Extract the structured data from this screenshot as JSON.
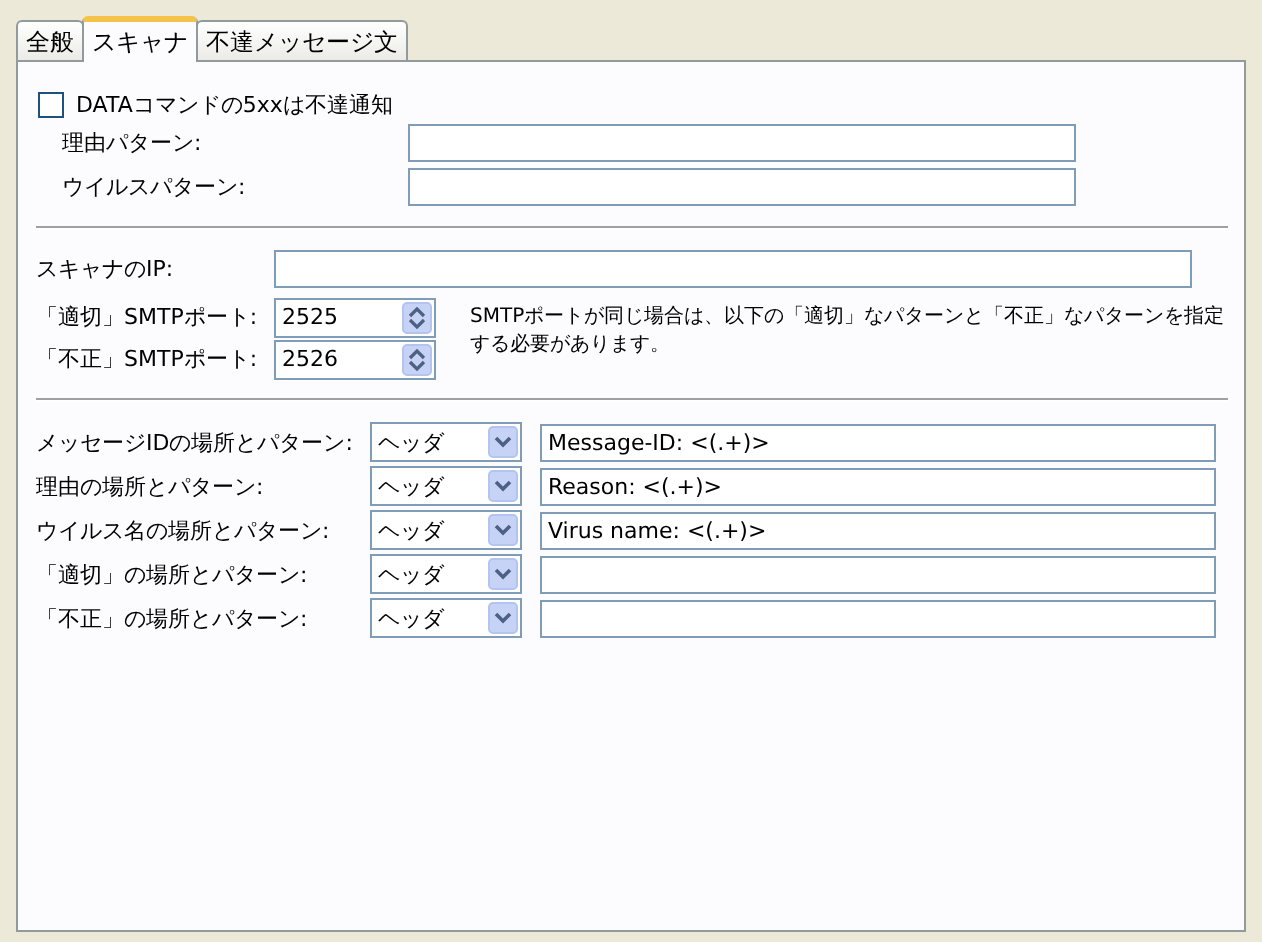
{
  "tabs": [
    {
      "label": "全般",
      "selected": false
    },
    {
      "label": "スキャナ",
      "selected": true
    },
    {
      "label": "不達メッセージ文",
      "selected": false
    }
  ],
  "dsn": {
    "label": "DATAコマンドの5xxは不達通知",
    "checked": false,
    "fields": [
      {
        "label": "理由パターン:"
      },
      {
        "label": "ウイルスパターン:"
      }
    ]
  },
  "scanner_ip": {
    "label": "スキャナのIP:"
  },
  "ports": [
    {
      "label": "「適切」SMTPポート:",
      "value": "2525"
    },
    {
      "label": "「不正」SMTPポート:",
      "value": "2526"
    }
  ],
  "port_note": "SMTPポートが同じ場合は、以下の「適切」なパターンと「不正」なパターンを指定する必要があります。",
  "patterns": [
    {
      "label": "メッセージIDの場所とパターン:",
      "location": "ヘッダ",
      "pattern": "Message-ID: <(.+)>"
    },
    {
      "label": "理由の場所とパターン:",
      "location": "ヘッダ",
      "pattern": "Reason: <(.+)>"
    },
    {
      "label": "ウイルス名の場所とパターン:",
      "location": "ヘッダ",
      "pattern": "Virus name: <(.+)>"
    },
    {
      "label": "「適切」の場所とパターン:",
      "location": "ヘッダ"
    },
    {
      "label": "「不正」の場所とパターン:",
      "location": "ヘッダ"
    }
  ]
}
